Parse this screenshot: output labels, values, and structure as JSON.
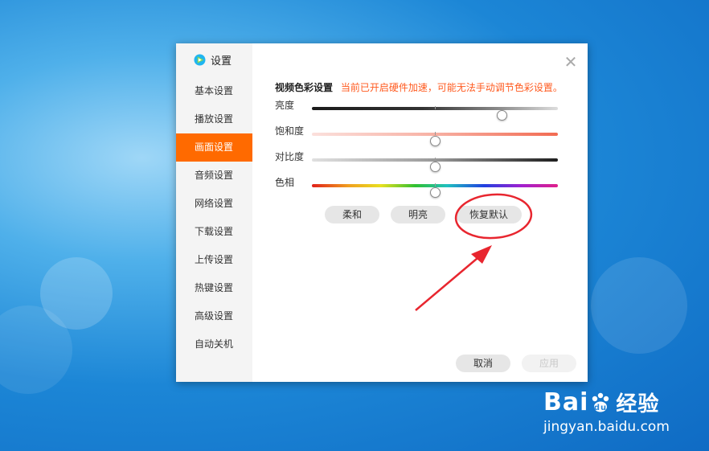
{
  "dialog": {
    "title": "设置",
    "nav": [
      {
        "label": "基本设置",
        "active": false
      },
      {
        "label": "播放设置",
        "active": false
      },
      {
        "label": "画面设置",
        "active": true
      },
      {
        "label": "音频设置",
        "active": false
      },
      {
        "label": "网络设置",
        "active": false
      },
      {
        "label": "下载设置",
        "active": false
      },
      {
        "label": "上传设置",
        "active": false
      },
      {
        "label": "热键设置",
        "active": false
      },
      {
        "label": "高级设置",
        "active": false
      },
      {
        "label": "自动关机",
        "active": false
      }
    ],
    "close_icon": "close-icon"
  },
  "video_color": {
    "section_title": "视频色彩设置",
    "warning": "当前已开启硬件加速，可能无法手动调节色彩设置。",
    "sliders": [
      {
        "label": "亮度",
        "value": 0.77
      },
      {
        "label": "饱和度",
        "value": 0.5
      },
      {
        "label": "对比度",
        "value": 0.5
      },
      {
        "label": "色相",
        "value": 0.5
      }
    ],
    "presets": {
      "soft": "柔和",
      "bright": "明亮",
      "reset": "恢复默认"
    }
  },
  "footer": {
    "cancel": "取消",
    "apply": "应用"
  },
  "watermark": {
    "logo_text": "Bai",
    "logo_suffix": "经验",
    "url": "jingyan.baidu.com"
  },
  "colors": {
    "accent": "#ff6a00",
    "warning": "#ff5a1f",
    "annotation": "#e8262f"
  }
}
